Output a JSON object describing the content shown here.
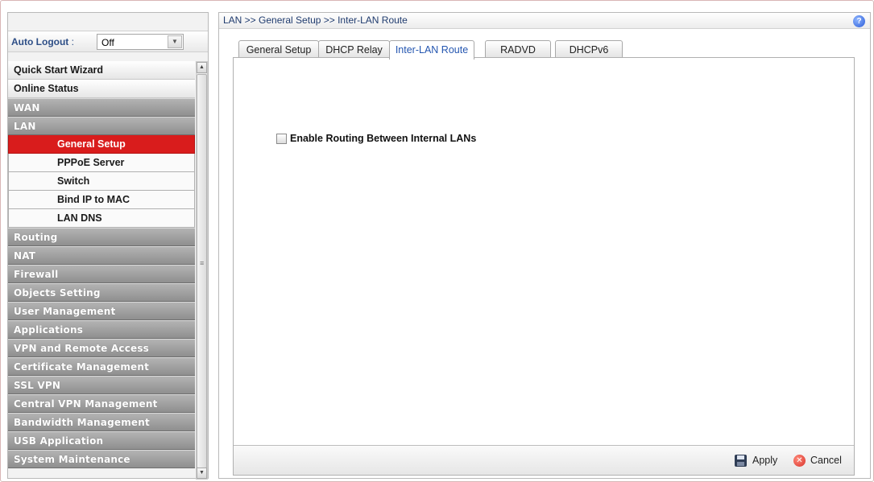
{
  "sidebar": {
    "auto_logout_label": "Auto Logout",
    "auto_logout_colon": " :",
    "auto_logout_value": "Off",
    "items": [
      {
        "label": "Quick Start Wizard",
        "kind": "top"
      },
      {
        "label": "Online Status",
        "kind": "top"
      },
      {
        "label": "WAN",
        "kind": "cat"
      },
      {
        "label": "LAN",
        "kind": "cat"
      },
      {
        "label": "General Setup",
        "kind": "sub",
        "active": true
      },
      {
        "label": "PPPoE Server",
        "kind": "sub"
      },
      {
        "label": "Switch",
        "kind": "sub"
      },
      {
        "label": "Bind IP to MAC",
        "kind": "sub"
      },
      {
        "label": "LAN DNS",
        "kind": "sub"
      },
      {
        "label": "Routing",
        "kind": "cat"
      },
      {
        "label": "NAT",
        "kind": "cat"
      },
      {
        "label": "Firewall",
        "kind": "cat"
      },
      {
        "label": "Objects Setting",
        "kind": "cat"
      },
      {
        "label": "User Management",
        "kind": "cat"
      },
      {
        "label": "Applications",
        "kind": "cat"
      },
      {
        "label": "VPN and Remote Access",
        "kind": "cat"
      },
      {
        "label": "Certificate Management",
        "kind": "cat"
      },
      {
        "label": "SSL VPN",
        "kind": "cat"
      },
      {
        "label": "Central VPN Management",
        "kind": "cat"
      },
      {
        "label": "Bandwidth Management",
        "kind": "cat"
      },
      {
        "label": "USB Application",
        "kind": "cat"
      },
      {
        "label": "System Maintenance",
        "kind": "cat"
      }
    ]
  },
  "main": {
    "breadcrumb": "LAN >> General Setup >> Inter-LAN Route",
    "help_icon": "?",
    "tabs": [
      {
        "label": "General Setup"
      },
      {
        "label": "DHCP Relay"
      },
      {
        "label": "Inter-LAN Route",
        "active": true
      },
      {
        "label": "RADVD"
      },
      {
        "label": "DHCPv6"
      }
    ],
    "enable_routing_label": "Enable Routing Between Internal LANs",
    "enable_routing_checked": false,
    "apply_label": "Apply",
    "cancel_label": "Cancel"
  },
  "colors": {
    "accent_active": "#d91c1c",
    "category_bg": "#a3a3a3",
    "tab_active_text": "#2456b0"
  }
}
